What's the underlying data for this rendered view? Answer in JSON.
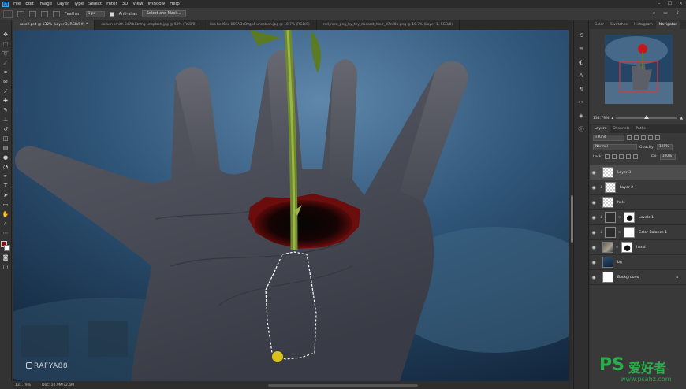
{
  "menubar": {
    "logo": "Ps",
    "items": [
      "File",
      "Edit",
      "Image",
      "Layer",
      "Type",
      "Select",
      "Filter",
      "3D",
      "View",
      "Window",
      "Help"
    ]
  },
  "options": {
    "feather_label": "Feather:",
    "feather_value": "1 px",
    "antialias_label": "Anti-alias",
    "select_mask_button": "Select and Mask..."
  },
  "tabs": [
    {
      "label": "rose2.psd @ 132% (Layer 3, RGB/8#) *",
      "active": true
    },
    {
      "label": "callum smith 8d7fb8b0ng unsplash.jpg @ 50% (RGB/8)",
      "active": false
    },
    {
      "label": "lisa hell6ha 069ADoB9gs4 unsplash.jpg @ 16.7% (RGB/8)",
      "active": false
    },
    {
      "label": "red_rose_png_by_thy_darkest_hour_d7cd6b.png @ 16.7% (Layer 1, RGB/8)",
      "active": false
    }
  ],
  "canvas": {
    "watermark": "RAFYA88"
  },
  "status": {
    "zoom": "131.79%",
    "doc": "Doc: 10.9M/72.6M"
  },
  "navigator": {
    "tabs": [
      "Color",
      "Swatches",
      "Histogram",
      "Navigator"
    ],
    "active_tab": "Navigator",
    "zoom": "131.79%"
  },
  "layers_panel": {
    "tabs": [
      "Layers",
      "Channels",
      "Paths"
    ],
    "active_tab": "Layers",
    "filter": "Kind",
    "blend_mode": "Normal",
    "opacity_label": "Opacity:",
    "opacity_value": "100%",
    "lock_label": "Lock:",
    "fill_label": "Fill:",
    "fill_value": "100%",
    "layers": [
      {
        "name": "Layer 3",
        "thumb": "check",
        "mask": false,
        "clip": false,
        "selected": true,
        "italic": false
      },
      {
        "name": "Layer 2",
        "thumb": "check",
        "mask": false,
        "clip": true,
        "selected": false,
        "italic": false
      },
      {
        "name": "hole",
        "thumb": "check",
        "mask": false,
        "clip": false,
        "selected": false,
        "italic": false
      },
      {
        "name": "Levels 1",
        "thumb": "adj",
        "mask": "blk",
        "clip": true,
        "selected": false,
        "italic": false
      },
      {
        "name": "Color Balance 1",
        "thumb": "adj",
        "mask": "white",
        "clip": true,
        "selected": false,
        "italic": false
      },
      {
        "name": "hand",
        "thumb": "hand",
        "mask": "blk",
        "clip": false,
        "selected": false,
        "italic": false
      },
      {
        "name": "bg",
        "thumb": "blue",
        "mask": false,
        "clip": false,
        "selected": false,
        "italic": false
      },
      {
        "name": "Background",
        "thumb": "white",
        "mask": false,
        "clip": false,
        "selected": false,
        "italic": true,
        "locked": true
      }
    ]
  },
  "brand": {
    "ps": "PS",
    "cn": "爱好者",
    "url": "www.psahz.com"
  }
}
